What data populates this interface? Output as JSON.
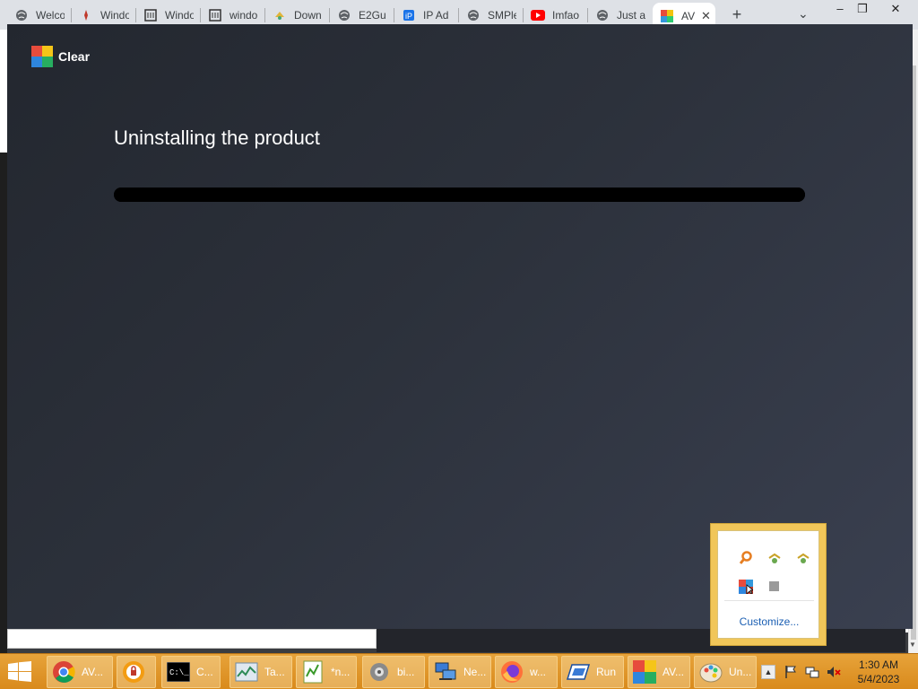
{
  "browser": {
    "tabs": [
      {
        "label": "Welco",
        "icon": "globe-icon"
      },
      {
        "label": "Windo",
        "icon": "windows-tab-icon"
      },
      {
        "label": "Windo",
        "icon": "bank-icon"
      },
      {
        "label": "windo",
        "icon": "bank-icon"
      },
      {
        "label": "Down",
        "icon": "download-tab-icon"
      },
      {
        "label": "E2Gu",
        "icon": "globe-icon"
      },
      {
        "label": "IP Ad",
        "icon": "ip-icon"
      },
      {
        "label": "SMPle",
        "icon": "globe-icon"
      },
      {
        "label": "Imfao",
        "icon": "youtube-icon"
      },
      {
        "label": "Just a",
        "icon": "globe-icon"
      },
      {
        "label": "AV",
        "icon": "avg-icon"
      }
    ],
    "new_tab": "+",
    "tab_search": "⌄",
    "window_controls": {
      "minimize": "–",
      "restore": "❐",
      "close": "✕"
    }
  },
  "installer": {
    "brand": "Clear",
    "title": "Uninstalling the product",
    "progress_fraction": 1.0
  },
  "tray_popup": {
    "icons": [
      "search-tray-icon",
      "network-wrench-icon",
      "network-wrench-icon-2",
      "avg-tray-icon",
      "gray-square-icon"
    ],
    "customize_label": "Customize..."
  },
  "taskbar": {
    "items": [
      {
        "label": "AV...",
        "icon": "chrome-icon"
      },
      {
        "label": "",
        "icon": "lock-app-icon"
      },
      {
        "label": "C...",
        "icon": "cmd-icon"
      },
      {
        "label": "Ta...",
        "icon": "task-manager-icon"
      },
      {
        "label": "*n...",
        "icon": "notepad-icon"
      },
      {
        "label": "bi...",
        "icon": "gear-app-icon"
      },
      {
        "label": "Ne...",
        "icon": "network-icon"
      },
      {
        "label": "w...",
        "icon": "firefox-icon"
      },
      {
        "label": "Run",
        "icon": "run-icon"
      },
      {
        "label": "AV...",
        "icon": "avg-icon"
      },
      {
        "label": "Un...",
        "icon": "paint-icon"
      }
    ],
    "clock_time": "1:30 AM",
    "clock_date": "5/4/2023"
  },
  "colors": {
    "accent_taskbar": "#d98a1c",
    "installer_bg": "#2c313b"
  }
}
